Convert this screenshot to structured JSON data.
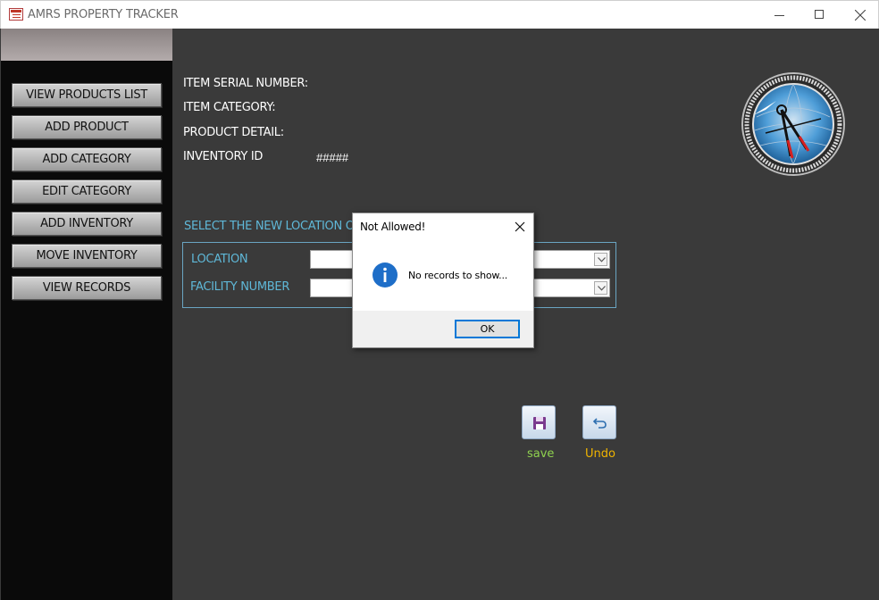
{
  "window": {
    "title": "AMRS PROPERTY TRACKER"
  },
  "sidebar": {
    "items": [
      {
        "label": "VIEW PRODUCTS LIST"
      },
      {
        "label": "ADD PRODUCT"
      },
      {
        "label": "ADD CATEGORY"
      },
      {
        "label": "EDIT CATEGORY"
      },
      {
        "label": "ADD INVENTORY"
      },
      {
        "label": "MOVE INVENTORY"
      },
      {
        "label": "VIEW RECORDS"
      }
    ]
  },
  "form": {
    "serial_label": "ITEM SERIAL NUMBER:",
    "category_label": "ITEM CATEGORY:",
    "detail_label": "PRODUCT DETAIL:",
    "inventory_id_label": "INVENTORY ID",
    "inventory_id_value": "#####",
    "select_location_label": "SELECT THE NEW LOCATION OF",
    "location_label": "LOCATION",
    "location_value": "",
    "facility_label": "FACILITY NUMBER",
    "facility_value": ""
  },
  "actions": {
    "save_label": "save",
    "undo_label": "Undo"
  },
  "dialog": {
    "title": "Not Allowed!",
    "message": "No records to show...",
    "ok_label": "OK"
  },
  "colors": {
    "background": "#3a3a3a",
    "sidebar": "#0a0a0a",
    "accent_cyan": "#5fb8d8",
    "save_label": "#8fd14f",
    "undo_label": "#f0b400"
  }
}
